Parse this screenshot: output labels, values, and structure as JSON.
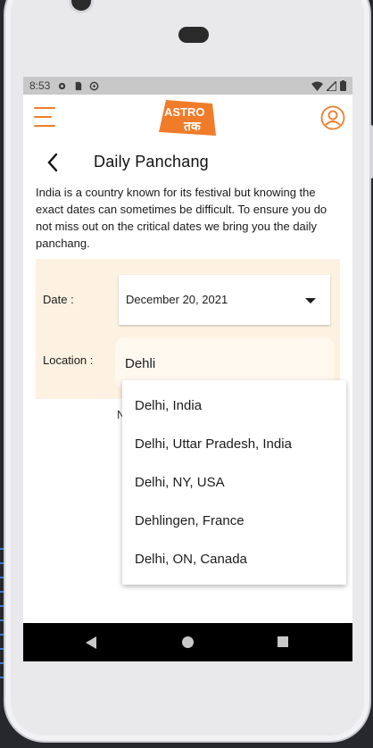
{
  "status_bar": {
    "time": "8:53",
    "icons": [
      "settings-icon",
      "sd-card-icon",
      "sync-icon",
      "wifi-icon",
      "signal-icon",
      "battery-icon"
    ]
  },
  "app_bar": {
    "logo_text_top": "ASTRO",
    "logo_text_bottom": "तक",
    "accent_color": "#f07c2a"
  },
  "page": {
    "title": "Daily Panchang",
    "intro": "India is a country known for its festival but knowing the exact dates can sometimes be difficult. To ensure you do not miss out on the critical dates we bring you the daily panchang."
  },
  "form": {
    "date_label": "Date :",
    "date_value": "December 20, 2021",
    "location_label": "Location :",
    "location_value": "Dehli",
    "card_color": "#fdf1e1"
  },
  "behind_dropdown_text": "N",
  "suggestions": [
    "Delhi, India",
    "Delhi, Uttar Pradesh, India",
    "Delhi, NY, USA",
    "Dehlingen, France",
    "Delhi, ON, Canada"
  ],
  "nav_bar": {
    "icons": [
      "nav-back-icon",
      "nav-home-icon",
      "nav-recents-icon"
    ]
  }
}
